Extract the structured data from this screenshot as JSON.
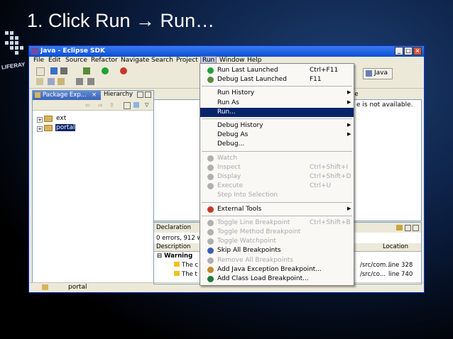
{
  "slide": {
    "title": "1.  Click Run → Run…",
    "logo_text": "LIFERAY"
  },
  "window": {
    "title": "Java - Eclipse SDK",
    "controls": [
      "_",
      "□",
      "×"
    ],
    "menu": [
      "File",
      "Edit",
      "Source",
      "Refactor",
      "Navigate",
      "Search",
      "Project",
      "Run",
      "Window",
      "Help"
    ],
    "perspective": "Java"
  },
  "package_explorer": {
    "tabs": [
      "Package Exp...",
      "Hierarchy"
    ],
    "items": [
      {
        "label": "ext",
        "selected": false
      },
      {
        "label": "portal",
        "selected": true
      }
    ]
  },
  "editor": {
    "tab_hint": "ne",
    "message": "e is not available."
  },
  "bottom_panel": {
    "tab": "Declaration",
    "errors": "0 errors, 912 wa",
    "columns": [
      "Description",
      "Location"
    ],
    "rows": [
      {
        "desc": "Warning",
        "path": "",
        "loc": ""
      },
      {
        "desc": "The c",
        "path": "/src/com...",
        "loc": "line 328"
      },
      {
        "desc": "The t",
        "path": "/src/co...",
        "loc": "line 740"
      }
    ]
  },
  "status": {
    "text": "portal"
  },
  "run_menu": {
    "items": [
      {
        "type": "item",
        "label": "Run Last Launched",
        "shortcut": "Ctrl+F11",
        "icon": "run-last-icon",
        "disabled": false
      },
      {
        "type": "item",
        "label": "Debug Last Launched",
        "shortcut": "F11",
        "icon": "debug-last-icon",
        "disabled": false
      },
      {
        "type": "sep"
      },
      {
        "type": "item",
        "label": "Run History",
        "submenu": true,
        "disabled": false
      },
      {
        "type": "item",
        "label": "Run As",
        "submenu": true,
        "disabled": false
      },
      {
        "type": "item",
        "label": "Run...",
        "highlighted": true,
        "disabled": false
      },
      {
        "type": "sep"
      },
      {
        "type": "item",
        "label": "Debug History",
        "submenu": true,
        "disabled": false
      },
      {
        "type": "item",
        "label": "Debug As",
        "submenu": true,
        "disabled": false
      },
      {
        "type": "item",
        "label": "Debug...",
        "disabled": false
      },
      {
        "type": "sep"
      },
      {
        "type": "item",
        "label": "Watch",
        "icon": "watch-icon",
        "disabled": true
      },
      {
        "type": "item",
        "label": "Inspect",
        "shortcut": "Ctrl+Shift+I",
        "icon": "inspect-icon",
        "disabled": true
      },
      {
        "type": "item",
        "label": "Display",
        "shortcut": "Ctrl+Shift+D",
        "icon": "display-icon",
        "disabled": true
      },
      {
        "type": "item",
        "label": "Execute",
        "shortcut": "Ctrl+U",
        "icon": "execute-icon",
        "disabled": true
      },
      {
        "type": "item",
        "label": "Step Into Selection",
        "disabled": true
      },
      {
        "type": "sep"
      },
      {
        "type": "item",
        "label": "External Tools",
        "submenu": true,
        "icon": "external-tools-icon",
        "disabled": false
      },
      {
        "type": "sep"
      },
      {
        "type": "item",
        "label": "Toggle Line Breakpoint",
        "shortcut": "Ctrl+Shift+B",
        "icon": "breakpoint-icon",
        "disabled": true
      },
      {
        "type": "item",
        "label": "Toggle Method Breakpoint",
        "icon": "method-breakpoint-icon",
        "disabled": true
      },
      {
        "type": "item",
        "label": "Toggle Watchpoint",
        "icon": "watchpoint-icon",
        "disabled": true
      },
      {
        "type": "item",
        "label": "Skip All Breakpoints",
        "icon": "skip-breakpoints-icon",
        "disabled": false
      },
      {
        "type": "item",
        "label": "Remove All Breakpoints",
        "icon": "remove-breakpoints-icon",
        "disabled": true
      },
      {
        "type": "item",
        "label": "Add Java Exception Breakpoint...",
        "icon": "exception-breakpoint-icon",
        "disabled": false
      },
      {
        "type": "item",
        "label": "Add Class Load Breakpoint...",
        "icon": "class-load-breakpoint-icon",
        "disabled": false
      }
    ]
  },
  "colors": {
    "menu_highlight": "#0a246a",
    "titlebar": "#0a4ed6",
    "disabled_text": "#a8a8a8"
  }
}
